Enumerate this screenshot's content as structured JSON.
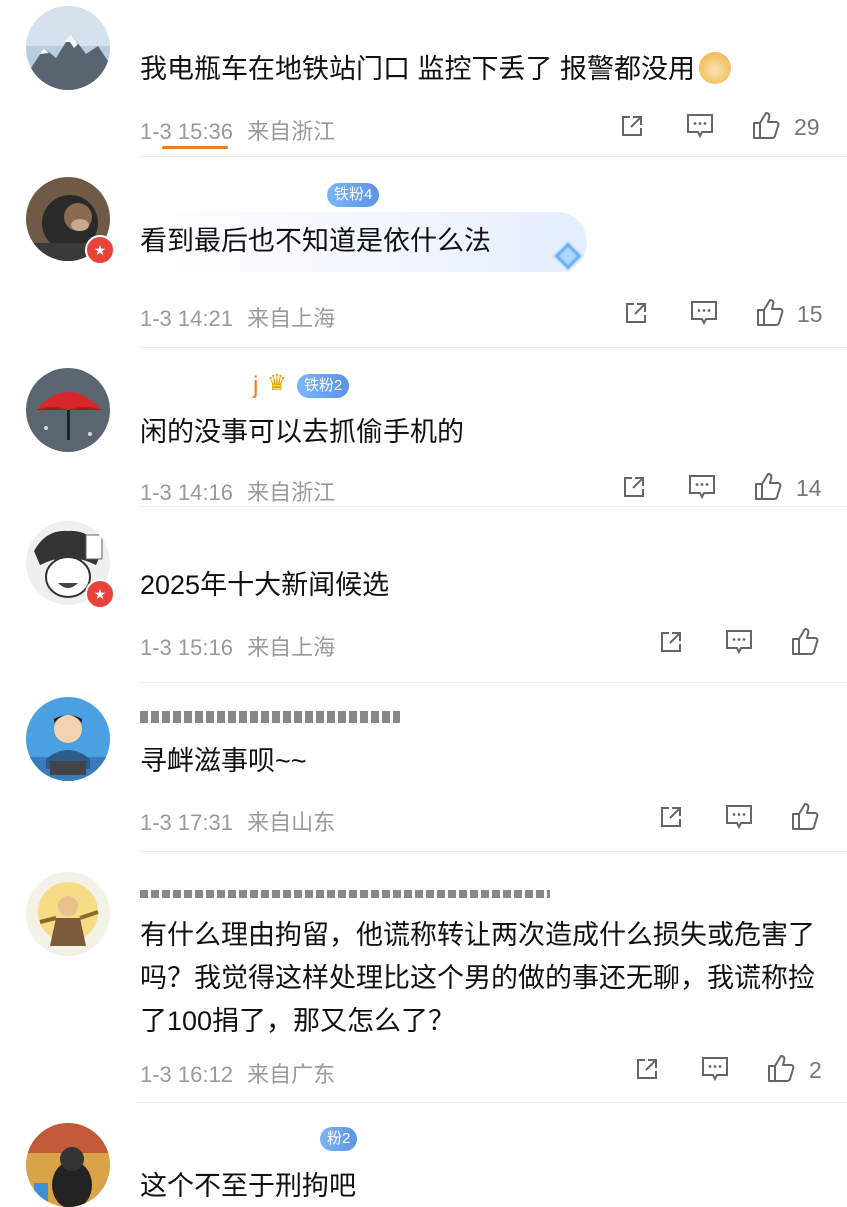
{
  "colors": {
    "accent": "#f07a1f",
    "fan_badge": "#6aa5f0",
    "verified_badge": "#e8423a",
    "meta_text": "#9a9a9a"
  },
  "icons": {
    "share": "share-icon",
    "comment": "comment-icon",
    "like": "thumbs-up-icon"
  },
  "comments": [
    {
      "text": "我电瓶车在地铁站门口 监控下丢了 报警都没用",
      "time": "1-3 15:36",
      "location": "来自浙江",
      "likes": "29",
      "emoji": "doge-emoji"
    },
    {
      "fan_badge": "铁粉4",
      "text": "看到最后也不知道是依什么法",
      "time": "1-3 14:21",
      "location": "来自上海",
      "likes": "15"
    },
    {
      "name": "j",
      "fan_badge": "铁粉2",
      "text": "闲的没事可以去抓偷手机的",
      "time": "1-3 14:16",
      "location": "来自浙江",
      "likes": "14"
    },
    {
      "text": "2025年十大新闻候选",
      "time": "1-3 15:16",
      "location": "来自上海",
      "likes": ""
    },
    {
      "text": "寻衅滋事呗~~",
      "time": "1-3 17:31",
      "location": "来自山东",
      "likes": ""
    },
    {
      "text": "有什么理由拘留，他谎称转让两次造成什么损失或危害了吗？我觉得这样处理比这个男的做的事还无聊，我谎称捡了100捐了，那又怎么了？",
      "time": "1-3 16:12",
      "location": "来自广东",
      "likes": "2"
    },
    {
      "fan_badge": "粉2",
      "text": "这个不至于刑拘吧"
    }
  ]
}
